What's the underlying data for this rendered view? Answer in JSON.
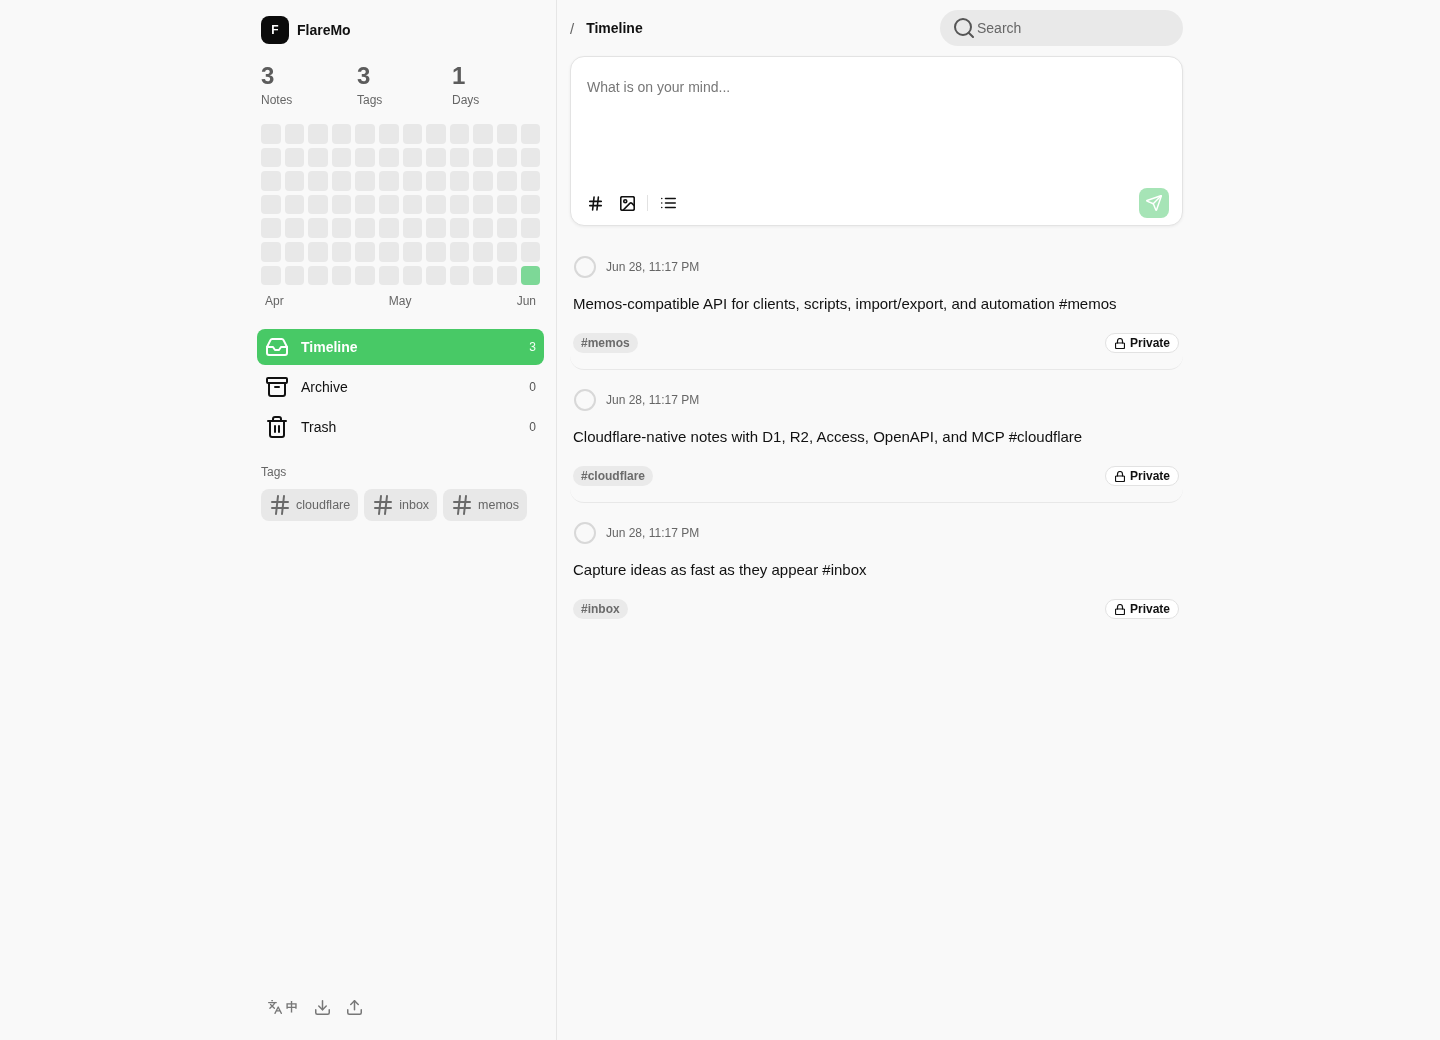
{
  "app": {
    "logo_letter": "F",
    "name": "FlareMo"
  },
  "stats": [
    {
      "value": "3",
      "label": "Notes"
    },
    {
      "value": "3",
      "label": "Tags"
    },
    {
      "value": "1",
      "label": "Days"
    }
  ],
  "heatmap": {
    "weeks": [
      {
        "days": [
          {
            "active": false
          },
          {
            "active": false
          },
          {
            "active": false
          },
          {
            "active": false
          },
          {
            "active": false
          },
          {
            "active": false
          },
          {
            "active": false
          }
        ]
      },
      {
        "days": [
          {
            "active": false
          },
          {
            "active": false
          },
          {
            "active": false
          },
          {
            "active": false
          },
          {
            "active": false
          },
          {
            "active": false
          },
          {
            "active": false
          }
        ]
      },
      {
        "days": [
          {
            "active": false
          },
          {
            "active": false
          },
          {
            "active": false
          },
          {
            "active": false
          },
          {
            "active": false
          },
          {
            "active": false
          },
          {
            "active": false
          }
        ]
      },
      {
        "days": [
          {
            "active": false
          },
          {
            "active": false
          },
          {
            "active": false
          },
          {
            "active": false
          },
          {
            "active": false
          },
          {
            "active": false
          },
          {
            "active": false
          }
        ]
      },
      {
        "days": [
          {
            "active": false
          },
          {
            "active": false
          },
          {
            "active": false
          },
          {
            "active": false
          },
          {
            "active": false
          },
          {
            "active": false
          },
          {
            "active": false
          }
        ]
      },
      {
        "days": [
          {
            "active": false
          },
          {
            "active": false
          },
          {
            "active": false
          },
          {
            "active": false
          },
          {
            "active": false
          },
          {
            "active": false
          },
          {
            "active": false
          }
        ]
      },
      {
        "days": [
          {
            "active": false
          },
          {
            "active": false
          },
          {
            "active": false
          },
          {
            "active": false
          },
          {
            "active": false
          },
          {
            "active": false
          },
          {
            "active": false
          }
        ]
      },
      {
        "days": [
          {
            "active": false
          },
          {
            "active": false
          },
          {
            "active": false
          },
          {
            "active": false
          },
          {
            "active": false
          },
          {
            "active": false
          },
          {
            "active": false
          }
        ]
      },
      {
        "days": [
          {
            "active": false
          },
          {
            "active": false
          },
          {
            "active": false
          },
          {
            "active": false
          },
          {
            "active": false
          },
          {
            "active": false
          },
          {
            "active": false
          }
        ]
      },
      {
        "days": [
          {
            "active": false
          },
          {
            "active": false
          },
          {
            "active": false
          },
          {
            "active": false
          },
          {
            "active": false
          },
          {
            "active": false
          },
          {
            "active": false
          }
        ]
      },
      {
        "days": [
          {
            "active": false
          },
          {
            "active": false
          },
          {
            "active": false
          },
          {
            "active": false
          },
          {
            "active": false
          },
          {
            "active": false
          },
          {
            "active": false
          }
        ]
      },
      {
        "days": [
          {
            "active": false
          },
          {
            "active": false
          },
          {
            "active": false
          },
          {
            "active": false
          },
          {
            "active": false
          },
          {
            "active": false
          },
          {
            "active": true
          }
        ]
      }
    ],
    "months": [
      "Apr",
      "May",
      "Jun"
    ]
  },
  "nav": [
    {
      "kind": "inbox",
      "label": "Timeline",
      "count": "3",
      "selected": true
    },
    {
      "kind": "archive",
      "label": "Archive",
      "count": "0",
      "selected": false
    },
    {
      "kind": "trash",
      "label": "Trash",
      "count": "0",
      "selected": false
    }
  ],
  "tags": {
    "title": "Tags",
    "items": [
      {
        "label": "cloudflare"
      },
      {
        "label": "inbox"
      },
      {
        "label": "memos"
      }
    ]
  },
  "footer": {
    "language_label": "中"
  },
  "header": {
    "separator": "/",
    "title": "Timeline"
  },
  "search": {
    "placeholder": "Search"
  },
  "composer": {
    "placeholder": "What is on your mind...",
    "send_button": {
      "disabled": true
    }
  },
  "memos": [
    {
      "checked": false,
      "date": "Jun 28, 11:17 PM",
      "text": "Memos-compatible API for clients, scripts, import/export, and automation #memos",
      "tags": [
        "#memos"
      ],
      "visibility": "Private"
    },
    {
      "checked": false,
      "date": "Jun 28, 11:17 PM",
      "text": "Cloudflare-native notes with D1, R2, Access, OpenAPI, and MCP #cloudflare",
      "tags": [
        "#cloudflare"
      ],
      "visibility": "Private"
    },
    {
      "checked": false,
      "date": "Jun 28, 11:17 PM",
      "text": "Capture ideas as fast as they appear #inbox",
      "tags": [
        "#inbox"
      ],
      "visibility": "Private"
    }
  ]
}
